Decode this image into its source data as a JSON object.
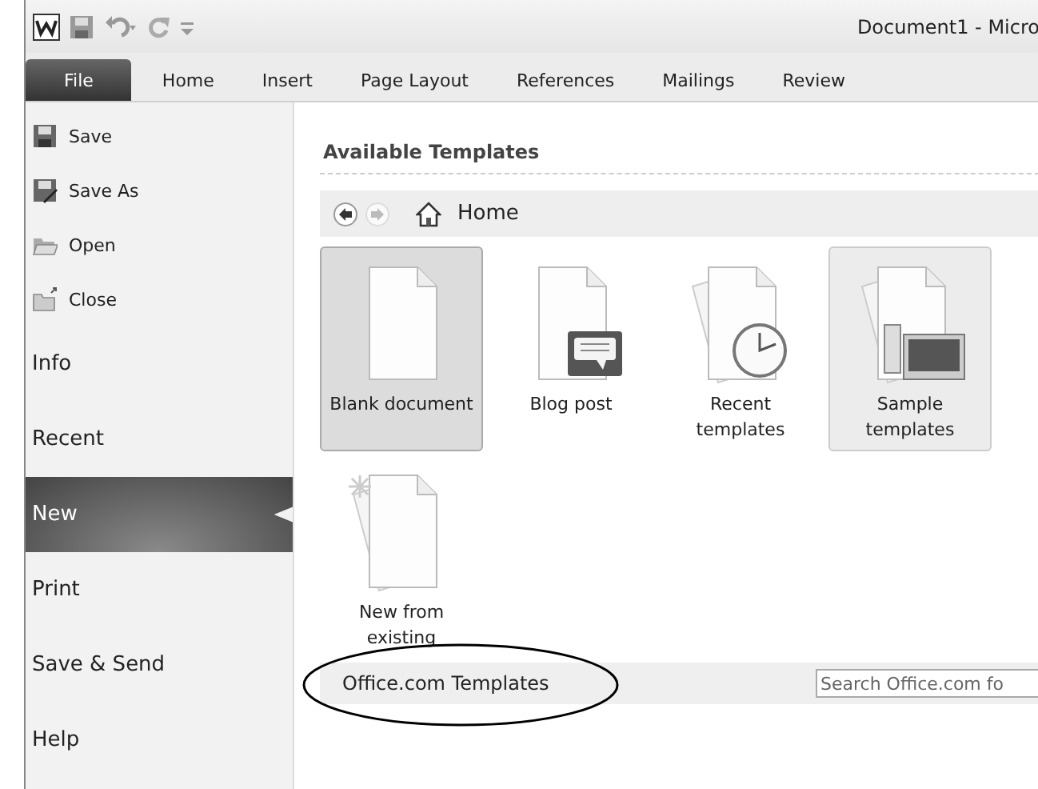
{
  "window": {
    "title": "Document1 - Micro"
  },
  "ribbon_tabs": [
    {
      "label": "File",
      "selected": true
    },
    {
      "label": "Home",
      "selected": false
    },
    {
      "label": "Insert",
      "selected": false
    },
    {
      "label": "Page Layout",
      "selected": false
    },
    {
      "label": "References",
      "selected": false
    },
    {
      "label": "Mailings",
      "selected": false
    },
    {
      "label": "Review",
      "selected": false
    }
  ],
  "sidebar": {
    "items": [
      {
        "kind": "command",
        "label": "Save",
        "selected": false
      },
      {
        "kind": "command",
        "label": "Save As",
        "selected": false
      },
      {
        "kind": "command",
        "label": "Open",
        "selected": false
      },
      {
        "kind": "command",
        "label": "Close",
        "selected": false
      },
      {
        "kind": "section",
        "label": "Info",
        "selected": false
      },
      {
        "kind": "section",
        "label": "Recent",
        "selected": false
      },
      {
        "kind": "section",
        "label": "New",
        "selected": true
      },
      {
        "kind": "section",
        "label": "Print",
        "selected": false
      },
      {
        "kind": "section",
        "label": "Save & Send",
        "selected": false
      },
      {
        "kind": "section",
        "label": "Help",
        "selected": false
      }
    ]
  },
  "templates": {
    "heading": "Available Templates",
    "breadcrumb": "Home",
    "items": [
      {
        "label": "Blank document",
        "selected": true,
        "hovered": false
      },
      {
        "label": "Blog post",
        "selected": false,
        "hovered": false
      },
      {
        "label": "Recent templates",
        "selected": false,
        "hovered": false
      },
      {
        "label": "Sample templates",
        "selected": false,
        "hovered": true
      },
      {
        "label": "New from existing",
        "selected": false,
        "hovered": false
      }
    ]
  },
  "office_section": {
    "title": "Office.com Templates",
    "search_placeholder": "Search Office.com fo",
    "circled": true
  }
}
